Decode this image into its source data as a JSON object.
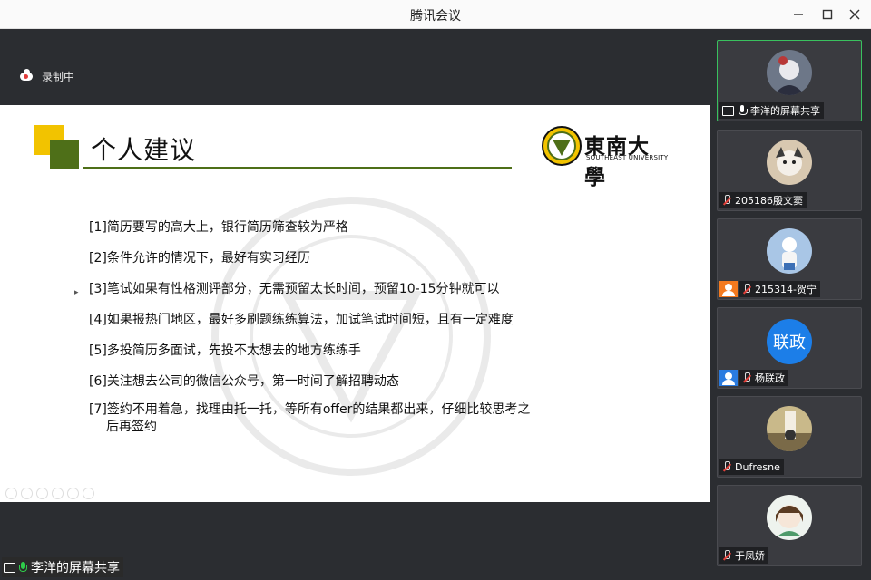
{
  "window": {
    "title": "腾讯会议"
  },
  "recording": {
    "label": "录制中"
  },
  "slide": {
    "title": "个人建议",
    "logo_cn": "東南大學",
    "logo_en": "SOUTHEAST UNIVERSITY",
    "items": [
      "[1]简历要写的高大上，银行简历筛查较为严格",
      "[2]条件允许的情况下，最好有实习经历",
      "[3]笔试如果有性格测评部分，无需预留太长时间，预留10-15分钟就可以",
      "[4]如果报热门地区，最好多刷题练练算法，加试笔试时间短，且有一定难度",
      "[5]多投简历多面试，先投不太想去的地方练练手",
      "[6]关注想去公司的微信公众号，第一时间了解招聘动态"
    ],
    "item7_line1": "[7]签约不用着急，找理由托一托，等所有offer的结果都出来，仔细比较思考之",
    "item7_line2": "后再签约"
  },
  "share": {
    "label": "李洋的屏幕共享"
  },
  "participants": [
    {
      "name": "李洋的屏幕共享",
      "state": "sharing"
    },
    {
      "name": "205186殷文窦",
      "state": "muted"
    },
    {
      "name": "215314-贺宁",
      "state": "muted"
    },
    {
      "name": "杨联政",
      "state": "muted",
      "avatar_text": "联政"
    },
    {
      "name": "Dufresne",
      "state": "muted"
    },
    {
      "name": "于凤娇",
      "state": "muted"
    }
  ],
  "colors": {
    "accent_green": "#4e6f18",
    "accent_yellow": "#f2c300",
    "active_border": "#39c15e",
    "avatar_blue": "#1c7ee8"
  }
}
